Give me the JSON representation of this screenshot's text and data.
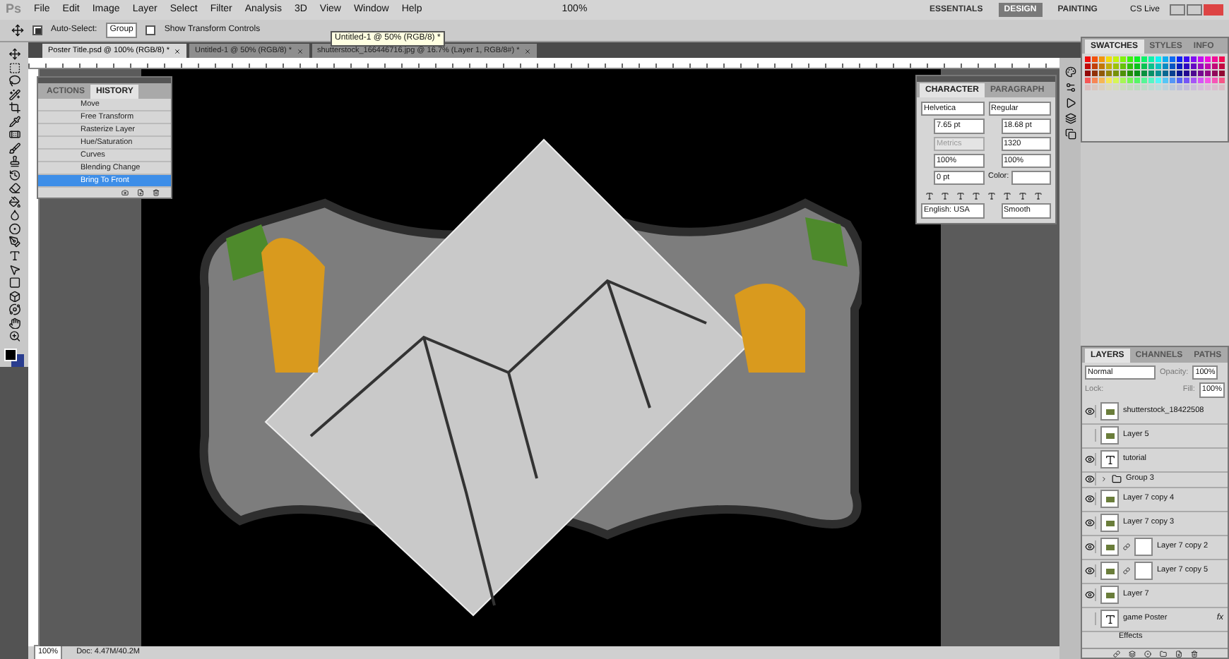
{
  "app": {
    "logo": "Ps",
    "menu": [
      "File",
      "Edit",
      "Image",
      "Layer",
      "Select",
      "Filter",
      "Analysis",
      "3D",
      "View",
      "Window",
      "Help"
    ],
    "zoom": "100%",
    "workspaces": [
      {
        "label": "ESSENTIALS",
        "selected": false
      },
      {
        "label": "DESIGN",
        "selected": true
      },
      {
        "label": "PAINTING",
        "selected": false
      }
    ],
    "cs_live": "CS Live"
  },
  "options_bar": {
    "auto_select": {
      "label": "Auto-Select:",
      "checked": true,
      "value": "Group"
    },
    "transform_controls": {
      "label": "Show Transform Controls",
      "checked": false
    }
  },
  "tooltip": "Untitled-1 @ 50% (RGB/8) *",
  "document_tabs": [
    {
      "label": "Poster Title.psd @ 100% (RGB/8) *",
      "selected": true
    },
    {
      "label": "Untitled-1 @ 50% (RGB/8) *",
      "selected": false
    },
    {
      "label": "shutterstock_166446716.jpg @ 16.7% (Layer 1, RGB/8#) *",
      "selected": false
    }
  ],
  "history_panel": {
    "tabs": [
      {
        "label": "ACTIONS",
        "selected": false
      },
      {
        "label": "HISTORY",
        "selected": true
      }
    ],
    "items": [
      {
        "label": "Move",
        "selected": false
      },
      {
        "label": "Free Transform",
        "selected": false
      },
      {
        "label": "Rasterize Layer",
        "selected": false
      },
      {
        "label": "Hue/Saturation",
        "selected": false
      },
      {
        "label": "Curves",
        "selected": false
      },
      {
        "label": "Blending Change",
        "selected": false
      },
      {
        "label": "Bring To Front",
        "selected": true
      }
    ]
  },
  "character_panel": {
    "tabs": [
      {
        "label": "CHARACTER",
        "selected": true
      },
      {
        "label": "PARAGRAPH",
        "selected": false
      }
    ],
    "font": "Helvetica",
    "style": "Regular",
    "size": "7.65 pt",
    "leading": "18.68 pt",
    "kerning": "Metrics",
    "tracking": "1320",
    "vertical_scale": "100%",
    "horizontal_scale": "100%",
    "baseline_shift": "0 pt",
    "color_label": "Color:",
    "language": "English: USA",
    "antialias": "Smooth"
  },
  "swatches_panel": {
    "tabs": [
      {
        "label": "SWATCHES",
        "selected": true
      },
      {
        "label": "STYLES",
        "selected": false
      },
      {
        "label": "INFO",
        "selected": false
      }
    ]
  },
  "layers_panel": {
    "tabs": [
      {
        "label": "LAYERS",
        "selected": true
      },
      {
        "label": "CHANNELS",
        "selected": false
      },
      {
        "label": "PATHS",
        "selected": false
      }
    ],
    "blend_mode": "Normal",
    "opacity_label": "Opacity:",
    "opacity": "100%",
    "lock_label": "Lock:",
    "fill_label": "Fill:",
    "fill": "100%",
    "layers": [
      {
        "name": "shutterstock_18422508",
        "kind": "image",
        "visible": true
      },
      {
        "name": "Layer 5",
        "kind": "image",
        "visible": false
      },
      {
        "name": "tutorial",
        "kind": "text",
        "visible": true
      },
      {
        "name": "Group 3",
        "kind": "group",
        "visible": true
      },
      {
        "name": "Layer 7 copy 4",
        "kind": "image",
        "visible": true
      },
      {
        "name": "Layer 7 copy 3",
        "kind": "image",
        "visible": true
      },
      {
        "name": "Layer 7 copy 2",
        "kind": "masked",
        "visible": true
      },
      {
        "name": "Layer 7 copy 5",
        "kind": "masked",
        "visible": true
      },
      {
        "name": "Layer 7",
        "kind": "image",
        "visible": true
      },
      {
        "name": "game Poster",
        "kind": "text",
        "visible": false,
        "fx": "fx",
        "effects_label": "Effects"
      }
    ]
  },
  "status_bar": {
    "zoom": "100%",
    "doc": "Doc: 4.47M/40.2M"
  }
}
